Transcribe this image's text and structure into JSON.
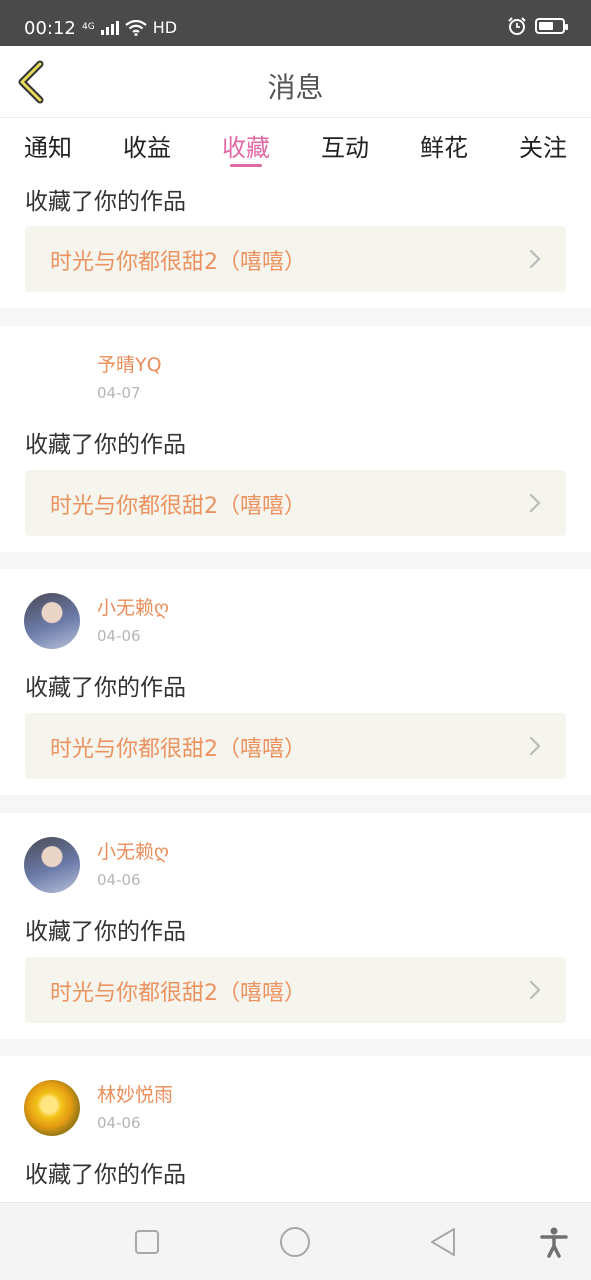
{
  "status_bar": {
    "time": "00:12",
    "network": "4G",
    "quality": "HD",
    "icons": [
      "signal-icon",
      "wifi-icon",
      "alarm-icon",
      "battery-icon"
    ]
  },
  "header": {
    "title": "消息",
    "back_icon": "chevron-left-icon"
  },
  "tabs": [
    {
      "label": "通知",
      "active": false
    },
    {
      "label": "收益",
      "active": false
    },
    {
      "label": "收藏",
      "active": true
    },
    {
      "label": "互动",
      "active": false
    },
    {
      "label": "鲜花",
      "active": false
    },
    {
      "label": "关注",
      "active": false
    }
  ],
  "feed": {
    "items": [
      {
        "user": "",
        "date": "",
        "action": "收藏了你的作品",
        "work_title": "时光与你都很甜2（嘻嘻）"
      },
      {
        "user": "予晴YQ",
        "date": "04-07",
        "action": "收藏了你的作品",
        "work_title": "时光与你都很甜2（嘻嘻）"
      },
      {
        "user": "小无赖ღ",
        "date": "04-06",
        "action": "收藏了你的作品",
        "work_title": "时光与你都很甜2（嘻嘻）"
      },
      {
        "user": "小无赖ღ",
        "date": "04-06",
        "action": "收藏了你的作品",
        "work_title": "时光与你都很甜2（嘻嘻）"
      },
      {
        "user": "林妙悦雨",
        "date": "04-06",
        "action": "收藏了你的作品",
        "work_title": ""
      }
    ]
  },
  "nav_bar": {
    "icons": [
      "square-recents-icon",
      "circle-home-icon",
      "triangle-back-icon",
      "accessibility-icon"
    ]
  },
  "colors": {
    "accent_pink": "#e06aa4",
    "username_orange": "#ea8d5a",
    "work_title_orange": "#ec9260",
    "work_bg": "#f5f5ee",
    "status_bar": "#4a4a4a"
  }
}
